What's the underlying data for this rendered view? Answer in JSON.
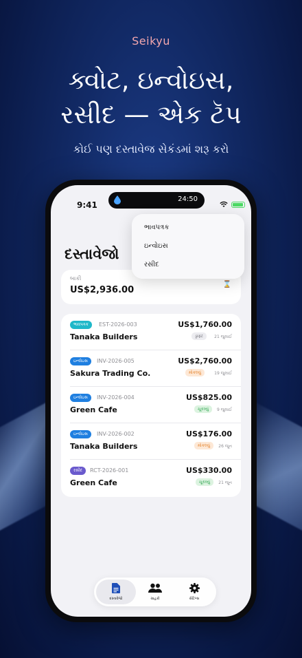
{
  "brand": "Seikyu",
  "headline_line1": "ક્વોટ, ઇન્વોઇસ,",
  "headline_line2": "રસીદ — એક ટૅપ",
  "subheadline": "કોઈ પણ દસ્તાવેજ સેકંડમાં શરૂ કરો",
  "status_bar": {
    "time": "9:41",
    "island_time": "24:50"
  },
  "page_title": "દસ્તાવેજો",
  "balance": {
    "label": "બાકી",
    "value": "US$2,936.00"
  },
  "dropdown": {
    "items": [
      "ભાવપત્રક",
      "ઇન્વોઇસ",
      "રસીદ"
    ]
  },
  "documents": [
    {
      "type": "ભાવપત્રક",
      "type_color": "#1fb8c9",
      "number": "EST-2026-003",
      "client": "Tanaka Builders",
      "amount": "US$1,760.00",
      "status": "ડ્રાફ્ટ",
      "status_bg": "#ececf0",
      "status_color": "#6b6b73",
      "date": "21 જુલાઈ"
    },
    {
      "type": "ઇન્વોઇસ",
      "type_color": "#1f7fe0",
      "number": "INV-2026-005",
      "client": "Sakura Trading Co.",
      "amount": "US$2,760.00",
      "status": "મોકલ્યું",
      "status_bg": "#fde8d6",
      "status_color": "#e4832c",
      "date": "19 જુલાઈ"
    },
    {
      "type": "ઇન્વોઇસ",
      "type_color": "#1f7fe0",
      "number": "INV-2026-004",
      "client": "Green Cafe",
      "amount": "US$825.00",
      "status": "ચૂકવ્યું",
      "status_bg": "#dcf3e0",
      "status_color": "#2ea44f",
      "date": "9 જુલાઈ"
    },
    {
      "type": "ઇન્વોઇસ",
      "type_color": "#1f7fe0",
      "number": "INV-2026-002",
      "client": "Tanaka Builders",
      "amount": "US$176.00",
      "status": "મોકલ્યું",
      "status_bg": "#fde8d6",
      "status_color": "#e4832c",
      "date": "26 જૂન"
    },
    {
      "type": "રસીદ",
      "type_color": "#6a5acd",
      "number": "RCT-2026-001",
      "client": "Green Cafe",
      "amount": "US$330.00",
      "status": "ચૂકવ્યું",
      "status_bg": "#dcf3e0",
      "status_color": "#2ea44f",
      "date": "21 જૂન"
    }
  ],
  "tabs": [
    {
      "label": "દસ્તાવેજો",
      "icon": "document-icon"
    },
    {
      "label": "ગ્રાહકો",
      "icon": "people-icon"
    },
    {
      "label": "સેટિંગ્સ",
      "icon": "gear-icon"
    }
  ],
  "colors": {
    "accent": "#1f7fe0",
    "brand_text": "#f3a7ae",
    "background": "#122a66"
  }
}
